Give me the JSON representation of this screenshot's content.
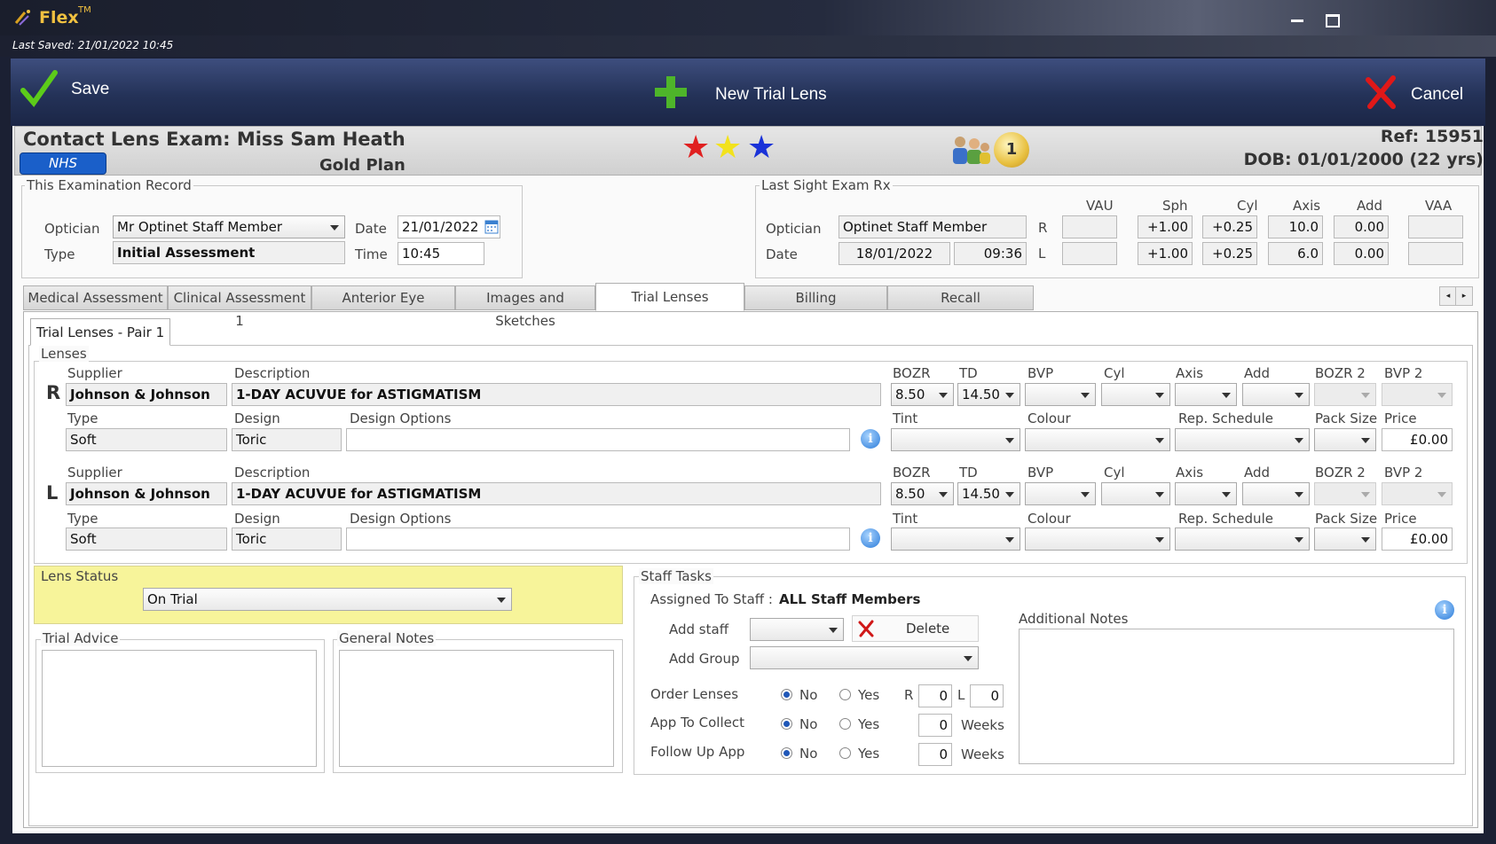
{
  "app": {
    "title": "Flex",
    "trademark": "TM",
    "last_saved": "Last Saved: 21/01/2022 10:45"
  },
  "toolbar": {
    "save_label": "Save",
    "new_trial_label": "New Trial Lens",
    "cancel_label": "Cancel"
  },
  "header": {
    "title": "Contact Lens Exam: Miss Sam Heath",
    "badge": "NHS",
    "plan": "Gold Plan",
    "stars": [
      "#e02020",
      "#f2e21c",
      "#1a32d8"
    ],
    "visits": "1",
    "ref": "Ref: 15951",
    "dob": "DOB: 01/01/2000 (22 yrs)"
  },
  "exam_record": {
    "legend": "This Examination Record",
    "optician_label": "Optician",
    "optician": "Mr Optinet Staff Member",
    "type_label": "Type",
    "type": "Initial Assessment",
    "date_label": "Date",
    "date": "21/01/2022",
    "time_label": "Time",
    "time": "10:45"
  },
  "last_sight": {
    "legend": "Last Sight Exam Rx",
    "optician_label": "Optician",
    "optician": "Optinet Staff Member",
    "date_label": "Date",
    "date": "18/01/2022",
    "time": "09:36",
    "columns": [
      "VAU",
      "Sph",
      "Cyl",
      "Axis",
      "Add",
      "VAA"
    ],
    "rows": [
      {
        "eye": "R",
        "vau": "",
        "sph": "+1.00",
        "cyl": "+0.25",
        "axis": "10.0",
        "add": "0.00",
        "vaa": ""
      },
      {
        "eye": "L",
        "vau": "",
        "sph": "+1.00",
        "cyl": "+0.25",
        "axis": "6.0",
        "add": "0.00",
        "vaa": ""
      }
    ]
  },
  "tabs": [
    "Medical Assessment",
    "Clinical Assessment 1",
    "Anterior Eye",
    "Images and Sketches",
    "Trial Lenses",
    "Billing",
    "Recall"
  ],
  "active_tab": "Trial Lenses",
  "subtab": "Trial Lenses - Pair 1",
  "lenses": {
    "legend": "Lenses",
    "labels": {
      "supplier": "Supplier",
      "description": "Description",
      "type": "Type",
      "design": "Design",
      "design_options": "Design Options",
      "bozr": "BOZR",
      "td": "TD",
      "bvp": "BVP",
      "cyl": "Cyl",
      "axis": "Axis",
      "add": "Add",
      "bozr2": "BOZR 2",
      "bvp2": "BVP 2",
      "tint": "Tint",
      "colour": "Colour",
      "rep_schedule": "Rep. Schedule",
      "pack_size": "Pack Size",
      "price": "Price"
    },
    "right": {
      "eye": "R",
      "supplier": "Johnson & Johnson",
      "description": "1-DAY ACUVUE for ASTIGMATISM",
      "type": "Soft",
      "design": "Toric",
      "design_options": "",
      "bozr": "8.50",
      "td": "14.50",
      "price": "£0.00"
    },
    "left": {
      "eye": "L",
      "supplier": "Johnson & Johnson",
      "description": "1-DAY ACUVUE for ASTIGMATISM",
      "type": "Soft",
      "design": "Toric",
      "design_options": "",
      "bozr": "8.50",
      "td": "14.50",
      "price": "£0.00"
    }
  },
  "lens_status": {
    "legend": "Lens Status",
    "value": "On Trial"
  },
  "trial_advice": {
    "legend": "Trial Advice"
  },
  "general_notes": {
    "legend": "General Notes"
  },
  "staff_tasks": {
    "legend": "Staff Tasks",
    "assigned_label": "Assigned To Staff :",
    "assigned_value": "ALL Staff Members",
    "add_staff_label": "Add staff",
    "delete_label": "Delete",
    "add_group_label": "Add Group",
    "additional_notes_label": "Additional Notes",
    "order_lenses_label": "Order Lenses",
    "app_to_collect_label": "App To Collect",
    "follow_up_label": "Follow Up App",
    "no": "No",
    "yes": "Yes",
    "r_label": "R",
    "l_label": "L",
    "r_value": "0",
    "l_value": "0",
    "collect_weeks": "0",
    "follow_weeks": "0",
    "weeks": "Weeks"
  }
}
